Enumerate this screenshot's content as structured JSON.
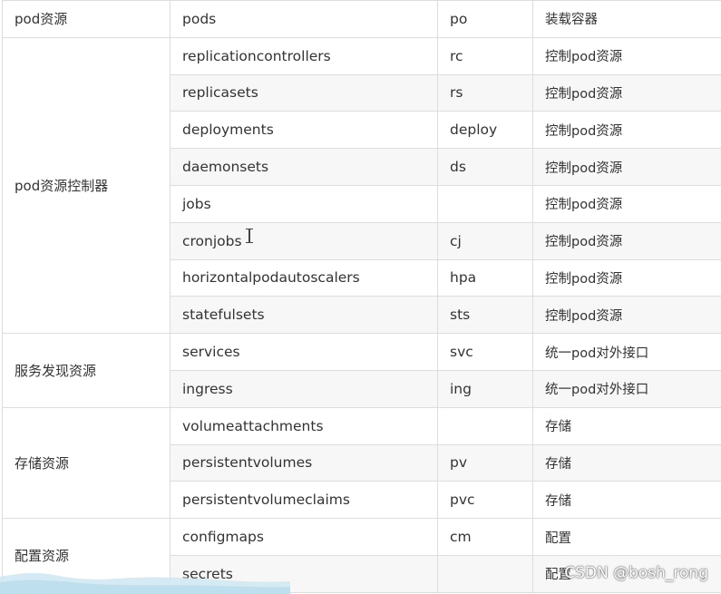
{
  "rows": [
    {
      "category": "pod资源",
      "name": "pods",
      "short": "po",
      "desc": "装载容器"
    },
    {
      "category": "pod资源控制器",
      "name": "replicationcontrollers",
      "short": "rc",
      "desc": "控制pod资源"
    },
    {
      "name": "replicasets",
      "short": "rs",
      "desc": "控制pod资源"
    },
    {
      "name": "deployments",
      "short": "deploy",
      "desc": "控制pod资源"
    },
    {
      "name": "daemonsets",
      "short": "ds",
      "desc": "控制pod资源"
    },
    {
      "name": "jobs",
      "short": "",
      "desc": "控制pod资源"
    },
    {
      "name": "cronjobs",
      "short": "cj",
      "desc": "控制pod资源"
    },
    {
      "name": "horizontalpodautoscalers",
      "short": "hpa",
      "desc": "控制pod资源"
    },
    {
      "name": "statefulsets",
      "short": "sts",
      "desc": "控制pod资源"
    },
    {
      "category": "服务发现资源",
      "name": "services",
      "short": "svc",
      "desc": "统一pod对外接口"
    },
    {
      "name": "ingress",
      "short": "ing",
      "desc": "统一pod对外接口"
    },
    {
      "category": "存储资源",
      "name": "volumeattachments",
      "short": "",
      "desc": "存储"
    },
    {
      "name": "persistentvolumes",
      "short": "pv",
      "desc": "存储"
    },
    {
      "name": "persistentvolumeclaims",
      "short": "pvc",
      "desc": "存储"
    },
    {
      "category": "配置资源",
      "name": "configmaps",
      "short": "cm",
      "desc": "配置"
    },
    {
      "name": "secrets",
      "short": "",
      "desc": "配置"
    }
  ],
  "watermark": "CSDN @bosh_rong",
  "icons": {
    "cursor": "text-cursor-icon"
  },
  "colors": {
    "border": "#dddddd",
    "stripe": "#f7f7f7",
    "text": "#333333"
  }
}
